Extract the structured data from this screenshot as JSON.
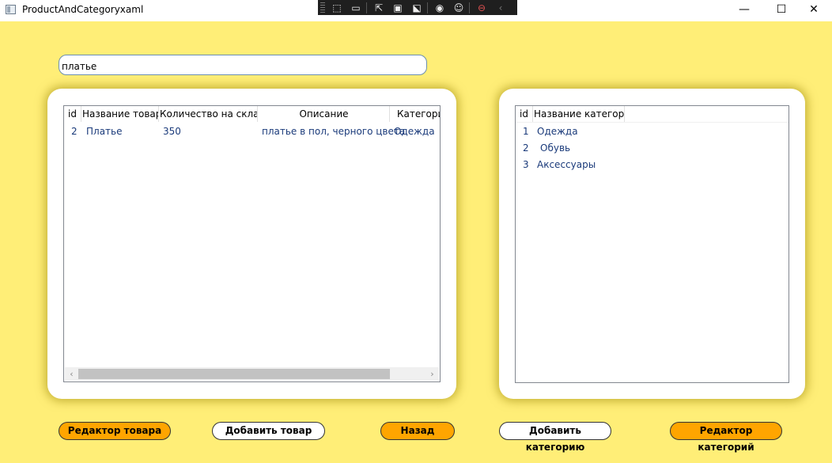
{
  "window": {
    "title": "ProductAndCategoryxaml",
    "minimize": "—",
    "maximize": "☐",
    "close": "✕"
  },
  "devtools": {
    "icons": [
      "select-element-icon",
      "record-icon",
      "pointer-icon",
      "adorner-icon",
      "track-focus-icon",
      "hot-reload-icon",
      "accessibility-icon",
      "stop-icon",
      "collapse-icon"
    ]
  },
  "search": {
    "value": "платье"
  },
  "products": {
    "columns": [
      "id",
      "Название товара",
      "Количество на складе",
      "Описание",
      "Категория"
    ],
    "rows": [
      [
        "2",
        "Платье",
        "350",
        "платье в пол, черного цвета",
        "Одежда"
      ]
    ]
  },
  "categories": {
    "columns": [
      "id",
      "Название категории"
    ],
    "rows": [
      [
        "1",
        "Одежда"
      ],
      [
        "2",
        "Обувь"
      ],
      [
        "3",
        "Аксессуары"
      ]
    ]
  },
  "buttons": {
    "edit_product": "Редактор товара",
    "add_product": "Добавить товар",
    "back": "Назад",
    "add_category": "Добавить категорию",
    "edit_category": "Редактор категорий"
  },
  "colors": {
    "background": "#FFEE77",
    "accent": "#FFA500",
    "row_text": "#1a3a7a"
  }
}
